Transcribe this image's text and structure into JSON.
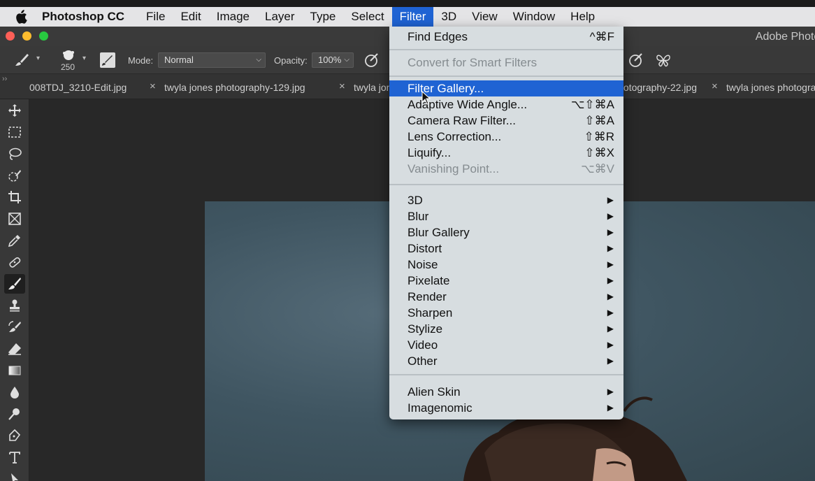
{
  "menubar": {
    "app_name": "Photoshop CC",
    "items": [
      "File",
      "Edit",
      "Image",
      "Layer",
      "Type",
      "Select",
      "Filter",
      "3D",
      "View",
      "Window",
      "Help"
    ],
    "active": "Filter"
  },
  "window": {
    "title": "Adobe Photoshop"
  },
  "options_bar": {
    "brush_size": "250",
    "mode_label": "Mode:",
    "mode_value": "Normal",
    "opacity_label": "Opacity:",
    "opacity_value": "100%"
  },
  "tabs": [
    {
      "label": "008TDJ_3210-Edit.jpg"
    },
    {
      "label": "twyla jones photography-129.jpg"
    },
    {
      "label": "twyla jones photography-22.jpg"
    },
    {
      "label": "twyla jones photography"
    }
  ],
  "filter_menu": {
    "items": [
      {
        "label": "Find Edges",
        "shortcut": "^⌘F",
        "disabled": false,
        "highlight": false,
        "submenu": false
      },
      {
        "label": "Convert for Smart Filters",
        "shortcut": "",
        "disabled": true,
        "highlight": false,
        "submenu": false
      },
      {
        "label": "Filter Gallery...",
        "shortcut": "",
        "disabled": false,
        "highlight": true,
        "submenu": false
      },
      {
        "label": "Adaptive Wide Angle...",
        "shortcut": "⌥⇧⌘A",
        "disabled": false,
        "highlight": false,
        "submenu": false
      },
      {
        "label": "Camera Raw Filter...",
        "shortcut": "⇧⌘A",
        "disabled": false,
        "highlight": false,
        "submenu": false
      },
      {
        "label": "Lens Correction...",
        "shortcut": "⇧⌘R",
        "disabled": false,
        "highlight": false,
        "submenu": false
      },
      {
        "label": "Liquify...",
        "shortcut": "⇧⌘X",
        "disabled": false,
        "highlight": false,
        "submenu": false
      },
      {
        "label": "Vanishing Point...",
        "shortcut": "⌥⌘V",
        "disabled": true,
        "highlight": false,
        "submenu": false
      },
      {
        "label": "3D",
        "shortcut": "",
        "disabled": false,
        "highlight": false,
        "submenu": true
      },
      {
        "label": "Blur",
        "shortcut": "",
        "disabled": false,
        "highlight": false,
        "submenu": true
      },
      {
        "label": "Blur Gallery",
        "shortcut": "",
        "disabled": false,
        "highlight": false,
        "submenu": true
      },
      {
        "label": "Distort",
        "shortcut": "",
        "disabled": false,
        "highlight": false,
        "submenu": true
      },
      {
        "label": "Noise",
        "shortcut": "",
        "disabled": false,
        "highlight": false,
        "submenu": true
      },
      {
        "label": "Pixelate",
        "shortcut": "",
        "disabled": false,
        "highlight": false,
        "submenu": true
      },
      {
        "label": "Render",
        "shortcut": "",
        "disabled": false,
        "highlight": false,
        "submenu": true
      },
      {
        "label": "Sharpen",
        "shortcut": "",
        "disabled": false,
        "highlight": false,
        "submenu": true
      },
      {
        "label": "Stylize",
        "shortcut": "",
        "disabled": false,
        "highlight": false,
        "submenu": true
      },
      {
        "label": "Video",
        "shortcut": "",
        "disabled": false,
        "highlight": false,
        "submenu": true
      },
      {
        "label": "Other",
        "shortcut": "",
        "disabled": false,
        "highlight": false,
        "submenu": true
      },
      {
        "label": "Alien Skin",
        "shortcut": "",
        "disabled": false,
        "highlight": false,
        "submenu": true
      },
      {
        "label": "Imagenomic",
        "shortcut": "",
        "disabled": false,
        "highlight": false,
        "submenu": true
      }
    ]
  },
  "colors": {
    "menu_highlight": "#1f63d3",
    "menu_bg": "#d7dde0",
    "traffic_close": "#fe5f57",
    "traffic_min": "#febc2e",
    "traffic_max": "#28c840"
  },
  "icons": {
    "tools": [
      "move-icon",
      "marquee-icon",
      "lasso-icon",
      "quick-select-icon",
      "crop-icon",
      "frame-icon",
      "eyedropper-icon",
      "healing-icon",
      "brush-icon",
      "stamp-icon",
      "history-brush-icon",
      "eraser-icon",
      "gradient-icon",
      "blur-icon",
      "dodge-icon",
      "pen-icon",
      "type-icon",
      "path-select-icon"
    ]
  }
}
